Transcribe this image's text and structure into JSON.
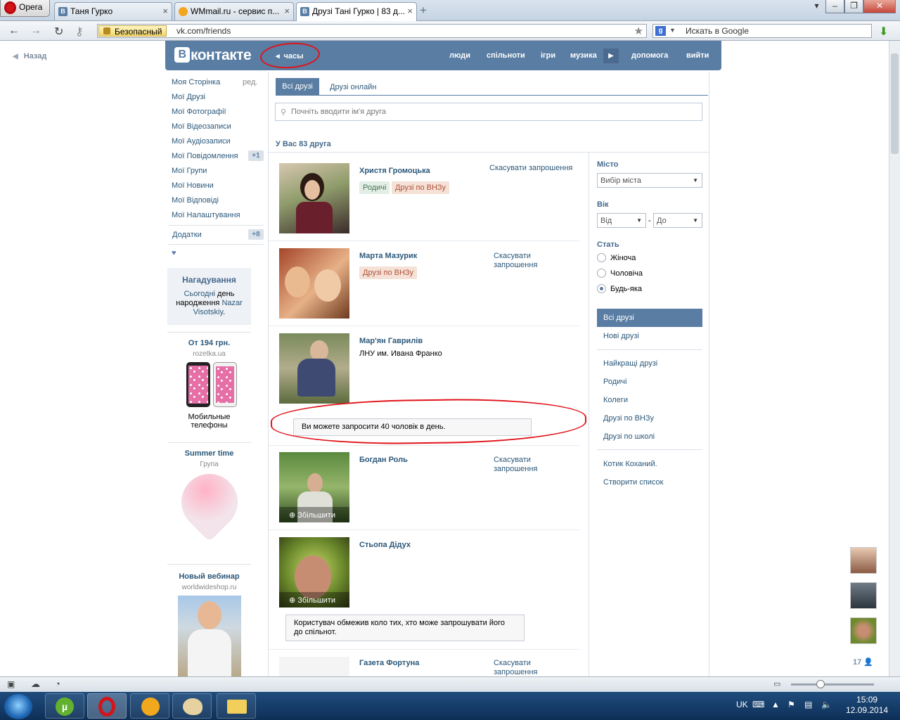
{
  "browser": {
    "menu_label": "Opera",
    "tabs": [
      {
        "label": "Таня Гурко"
      },
      {
        "label": "WMmail.ru - сервис п..."
      },
      {
        "label": "Друзі Тані Гурко | 83 д..."
      }
    ],
    "secure_label": "Безопасный",
    "url": "vk.com/friends",
    "search_placeholder": "Искать в Google"
  },
  "back_label": "Назад",
  "header": {
    "logo_b": "В",
    "logo_text": "контакте",
    "status": "часы",
    "nav": [
      "люди",
      "спільноти",
      "ігри",
      "музика",
      "допомога",
      "вийти"
    ]
  },
  "left_menu": {
    "items": [
      "Моя Сторінка",
      "Мої Друзі",
      "Мої Фотографії",
      "Мої Відеозаписи",
      "Мої Аудіозаписи",
      "Мої Повідомлення",
      "Мої Групи",
      "Мої Новини",
      "Мої Відповіді",
      "Мої Налаштування"
    ],
    "edit": "ред.",
    "messages_count": "+1",
    "apps_label": "Додатки",
    "apps_count": "+8",
    "heart": "♥"
  },
  "reminder": {
    "title": "Нагадування",
    "today": "Сьогодні",
    "text1": "день",
    "text2": "народження",
    "name1": "Nazar",
    "name2": "Visotskiy",
    "dot": "."
  },
  "ads": [
    {
      "title": "От 194 грн.",
      "source": "rozetka.ua",
      "desc1": "Мобильные",
      "desc2": "телефоны"
    },
    {
      "title": "Summer time",
      "source": "Група"
    },
    {
      "title": "Новый вебинар",
      "source": "worldwideshop.ru"
    }
  ],
  "main": {
    "tab_all": "Всі друзі",
    "tab_online": "Друзі онлайн",
    "search_placeholder": "Почніть вводити ім'я друга",
    "count_text": "У Вас 83 друга",
    "zoom_label": "Збільшити"
  },
  "friends": [
    {
      "name": "Христя Громоцька",
      "action": "Скасувати запрошення",
      "tags": [
        "Родичі",
        "Друзі по ВНЗу"
      ]
    },
    {
      "name": "Марта Мазурик",
      "action1": "Скасувати",
      "action2": "запрошення",
      "tags": [
        "Друзі по ВНЗу"
      ]
    },
    {
      "name": "Мар'ян Гаврилів",
      "sub": "ЛНУ им. Ивана Франко",
      "note": "Ви можете запросити 40 чоловік в день."
    },
    {
      "name": "Богдан Роль",
      "action1": "Скасувати",
      "action2": "запрошення"
    },
    {
      "name": "Стьопа Дідух",
      "note1": "Користувач обмежив коло тих, хто може запрошувати його",
      "note2": "до спільнот."
    },
    {
      "name": "Газета Фортуна",
      "action1": "Скасувати",
      "action2": "запрошення"
    }
  ],
  "filters": {
    "city_label": "Місто",
    "city_select": "Вибір міста",
    "age_label": "Вік",
    "age_from": "Від",
    "age_dash": "-",
    "age_to": "До",
    "sex_label": "Стать",
    "sex_options": [
      "Жіноча",
      "Чоловіча",
      "Будь-яка"
    ],
    "sex_selected": 2
  },
  "right_menu": {
    "active": "Всі друзі",
    "items": [
      "Нові друзі",
      "Найкращі друзі",
      "Родичі",
      "Колеги",
      "Друзі по ВНЗу",
      "Друзі по школі",
      "Котик Коханий.",
      "Створити список"
    ]
  },
  "online_count": "17",
  "taskbar": {
    "lang": "UK",
    "time": "15:09",
    "date": "12.09.2014"
  },
  "colors": {
    "vk_blue": "#597da3",
    "link": "#2b587a",
    "annotation_red": "#e0141a"
  }
}
